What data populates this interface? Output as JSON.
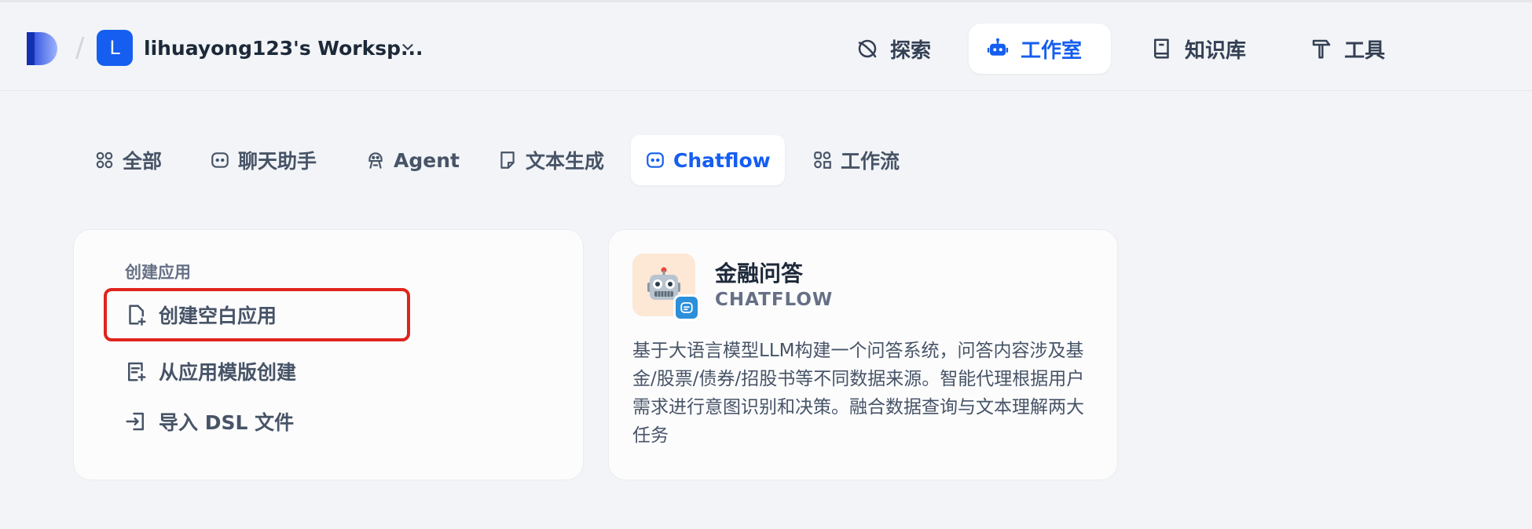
{
  "header": {
    "workspace_initial": "L",
    "workspace_name": "lihuayong123's Worksp...",
    "nav": [
      {
        "label": "探索",
        "icon": "compass-icon"
      },
      {
        "label": "工作室",
        "icon": "robot-icon",
        "active": true
      },
      {
        "label": "知识库",
        "icon": "book-icon"
      },
      {
        "label": "工具",
        "icon": "hammer-icon"
      }
    ]
  },
  "tabs": [
    {
      "label": "全部",
      "icon": "grid-icon"
    },
    {
      "label": "聊天助手",
      "icon": "chat-bot-icon"
    },
    {
      "label": "Agent",
      "icon": "agent-icon"
    },
    {
      "label": "文本生成",
      "icon": "document-icon"
    },
    {
      "label": "Chatflow",
      "icon": "chatflow-icon",
      "active": true
    },
    {
      "label": "工作流",
      "icon": "workflow-icon"
    }
  ],
  "create_card": {
    "title": "创建应用",
    "items": [
      {
        "label": "创建空白应用",
        "icon": "file-plus-icon"
      },
      {
        "label": "从应用模版创建",
        "icon": "template-icon"
      },
      {
        "label": "导入 DSL 文件",
        "icon": "import-icon"
      }
    ]
  },
  "app_card": {
    "title": "金融问答",
    "type": "CHATFLOW",
    "description": "基于大语言模型LLM构建一个问答系统，问答内容涉及基金/股票/债券/招股书等不同数据来源。智能代理根据用户需求进行意图识别和决策。融合数据查询与文本理解两大任务"
  },
  "colors": {
    "accent": "#155eef",
    "highlight": "#e0241b"
  }
}
